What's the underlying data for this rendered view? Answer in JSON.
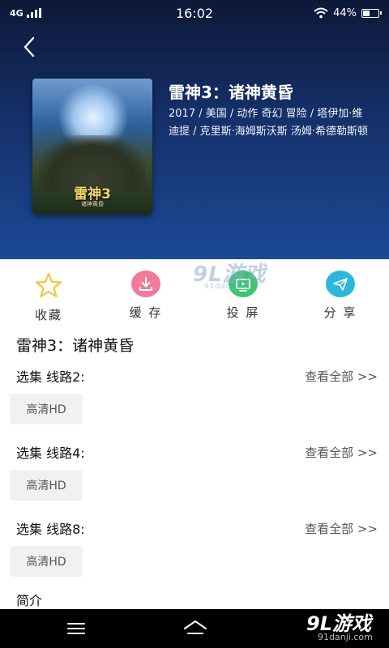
{
  "status_bar": {
    "network": "4G",
    "time": "16:02",
    "battery": "44%",
    "battery_level": 0.44
  },
  "movie": {
    "title": "雷神3：诸神黄昏",
    "meta": "2017 / 美国 / 动作 奇幻 冒险 / 塔伊加·维迪提 / 克里斯·海姆斯沃斯 汤姆·希德勒斯顿",
    "poster_title": "雷神3",
    "poster_subtitle": "诸神黄昏"
  },
  "actions": [
    {
      "label": "收藏",
      "icon": "star-icon",
      "color": "#f4d45a"
    },
    {
      "label": "缓 存",
      "icon": "download-icon",
      "color": "#f07a97"
    },
    {
      "label": "投 屏",
      "icon": "tv-icon",
      "color": "#3cc46f"
    },
    {
      "label": "分 享",
      "icon": "paper-plane-icon",
      "color": "#2bb7de"
    }
  ],
  "section_title": "雷神3：诸神黄昏",
  "episodes": [
    {
      "label": "选集 线路2:",
      "more": "查看全部 >>",
      "chip": "高清HD"
    },
    {
      "label": "选集 线路4:",
      "more": "查看全部 >>",
      "chip": "高清HD"
    },
    {
      "label": "选集 线路8:",
      "more": "查看全部 >>",
      "chip": "高清HD"
    }
  ],
  "intro_label": "简介",
  "watermark": {
    "mid": "9L游戏",
    "mid_sub": "91danji.com",
    "logo": "9L游戏",
    "url": "91danji.com"
  }
}
